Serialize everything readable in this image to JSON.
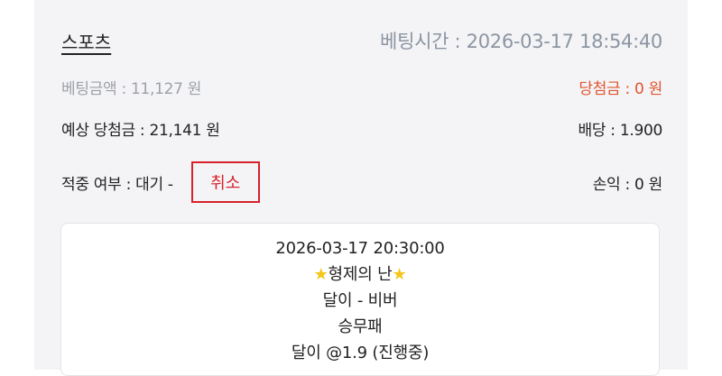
{
  "bet": {
    "category": "스포츠",
    "bet_time": "베팅시간 : 2026-03-17 18:54:40",
    "bet_amount": "베팅금액 : 11,127 원",
    "winnings": "당첨금 : 0 원",
    "expected_winnings": "예상 당첨금 : 21,141 원",
    "odds": "배당 : 1.900",
    "hit_status": "적중 여부 : 대기 -",
    "cancel_label": "취소",
    "profit_loss": "손익 : 0 원"
  },
  "detail": {
    "match_time": "2026-03-17 20:30:00",
    "league_icon": "star-icon",
    "league": "형제의 난",
    "teams": "달이 - 비버",
    "market": "승무패",
    "pick": "달이 @1.9 (진행중)"
  },
  "colors": {
    "accent_red": "#d8222a",
    "winnings_orange": "#e0552e",
    "muted_gray": "#9ca1a8"
  }
}
